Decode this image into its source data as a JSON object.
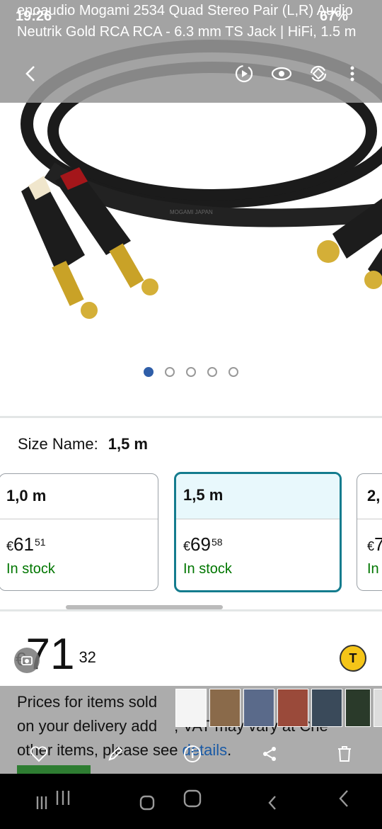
{
  "status_bar": {
    "time": "19:26",
    "battery": "67%"
  },
  "product": {
    "title_line1": "enoaudio Mogami 2534 Quad Stereo Pair (L,R) Audio",
    "title_line2": "Neutrik Gold RCA RCA - 6.3 mm TS Jack | HiFi, 1.5 m",
    "image_cable_print": "MOGAMI  JAPAN"
  },
  "gallery": {
    "image_count": 5,
    "active_index": 0
  },
  "size_selector": {
    "label": "Size Name:",
    "selected": "1,5 m",
    "options": [
      {
        "name": "1,0 m",
        "currency": "€",
        "whole": "61",
        "fraction": "51",
        "stock": "In stock"
      },
      {
        "name": "1,5 m",
        "currency": "€",
        "whole": "69",
        "fraction": "58",
        "stock": "In stock"
      },
      {
        "name": "2,",
        "currency": "€",
        "whole": "7",
        "fraction": "",
        "stock": "In"
      }
    ]
  },
  "price": {
    "currency": "€",
    "whole": "71",
    "fraction": "32"
  },
  "vat_notice": {
    "line1": "Prices for items sold",
    "line2": "on your delivery add",
    "line2_end": ", VAT may vary at Che",
    "line3": "other items, please see ",
    "link": "details",
    "line3_end": "."
  },
  "colors": {
    "selected_border": "#147c8e",
    "stock_green": "#007600",
    "link_blue": "#1a5aa5",
    "dot_active": "#2f5ea8"
  },
  "icons": [
    "back-icon",
    "edit-video-icon",
    "eye-icon",
    "rotate-icon",
    "more-icon",
    "heart-icon",
    "pencil-icon",
    "info-icon",
    "share-icon",
    "trash-icon",
    "recents-icon",
    "home-icon",
    "back-nav-icon"
  ]
}
